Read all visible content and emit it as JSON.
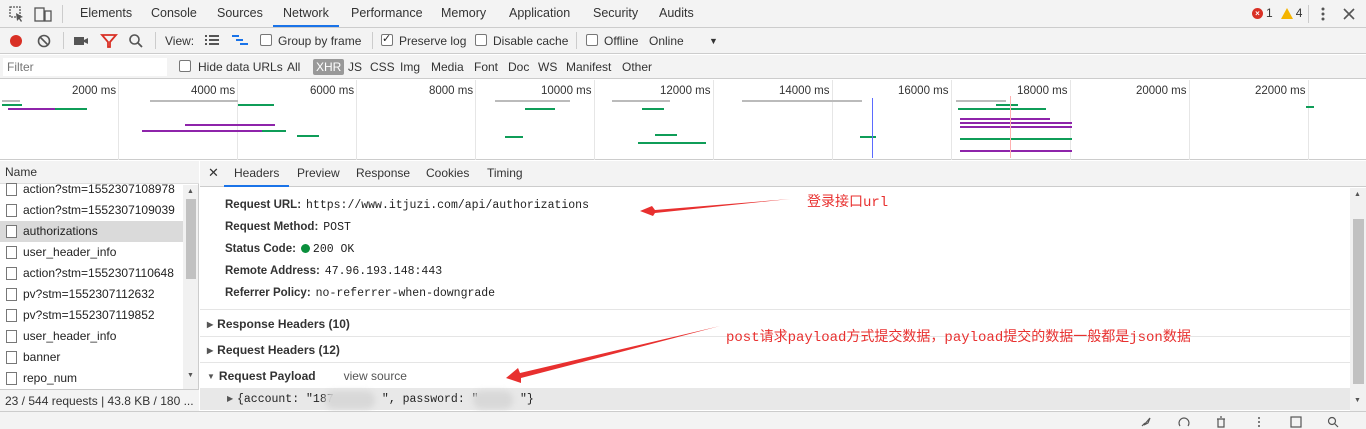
{
  "topbar": {
    "tabs": [
      "Elements",
      "Console",
      "Sources",
      "Network",
      "Performance",
      "Memory",
      "Application",
      "Security",
      "Audits"
    ],
    "active_tab": "Network",
    "errors": "1",
    "warnings": "4"
  },
  "toolbar": {
    "view_label": "View:",
    "group_by_frame": "Group by frame",
    "preserve_log": "Preserve log",
    "disable_cache": "Disable cache",
    "offline": "Offline",
    "throttle": "Online"
  },
  "filter": {
    "placeholder": "Filter",
    "hide_data_urls": "Hide data URLs",
    "types": [
      "All",
      "XHR",
      "JS",
      "CSS",
      "Img",
      "Media",
      "Font",
      "Doc",
      "WS",
      "Manifest",
      "Other"
    ],
    "active_type": "XHR"
  },
  "timeline": {
    "ticks": [
      "2000 ms",
      "4000 ms",
      "6000 ms",
      "8000 ms",
      "10000 ms",
      "12000 ms",
      "14000 ms",
      "16000 ms",
      "18000 ms",
      "20000 ms",
      "22000 ms"
    ]
  },
  "requests": {
    "header": "Name",
    "items": [
      "action?stm=1552307108978",
      "action?stm=1552307109039",
      "authorizations",
      "user_header_info",
      "action?stm=1552307110648",
      "pv?stm=1552307112632",
      "pv?stm=1552307119852",
      "user_header_info",
      "banner",
      "repo_num"
    ],
    "selected_index": 2
  },
  "status": {
    "summary": "23 / 544 requests | 43.8 KB / 180 ..."
  },
  "detail": {
    "tabs": [
      "Headers",
      "Preview",
      "Response",
      "Cookies",
      "Timing"
    ],
    "active_tab": "Headers",
    "general": {
      "url_label": "Request URL:",
      "url": "https://www.itjuzi.com/api/authorizations",
      "method_label": "Request Method:",
      "method": "POST",
      "status_label": "Status Code:",
      "status": "200 OK",
      "remote_label": "Remote Address:",
      "remote": "47.96.193.148:443",
      "referrer_label": "Referrer Policy:",
      "referrer": "no-referrer-when-downgrade"
    },
    "sections": {
      "response_headers": "Response Headers (10)",
      "request_headers": "Request Headers (12)",
      "request_payload": "Request Payload",
      "view_source": "view source"
    },
    "payload": "{account: \"187       \", password: \"      \"}"
  },
  "annotations": {
    "login": "登录接口url",
    "payload": "post请求payload方式提交数据，payload提交的数据一般都是json数据"
  },
  "colors": {
    "accent": "#1a73e8",
    "record": "#d93025",
    "annotation": "#e8302f",
    "bar_green": "#0f9d58",
    "bar_purple": "#8e24aa"
  }
}
